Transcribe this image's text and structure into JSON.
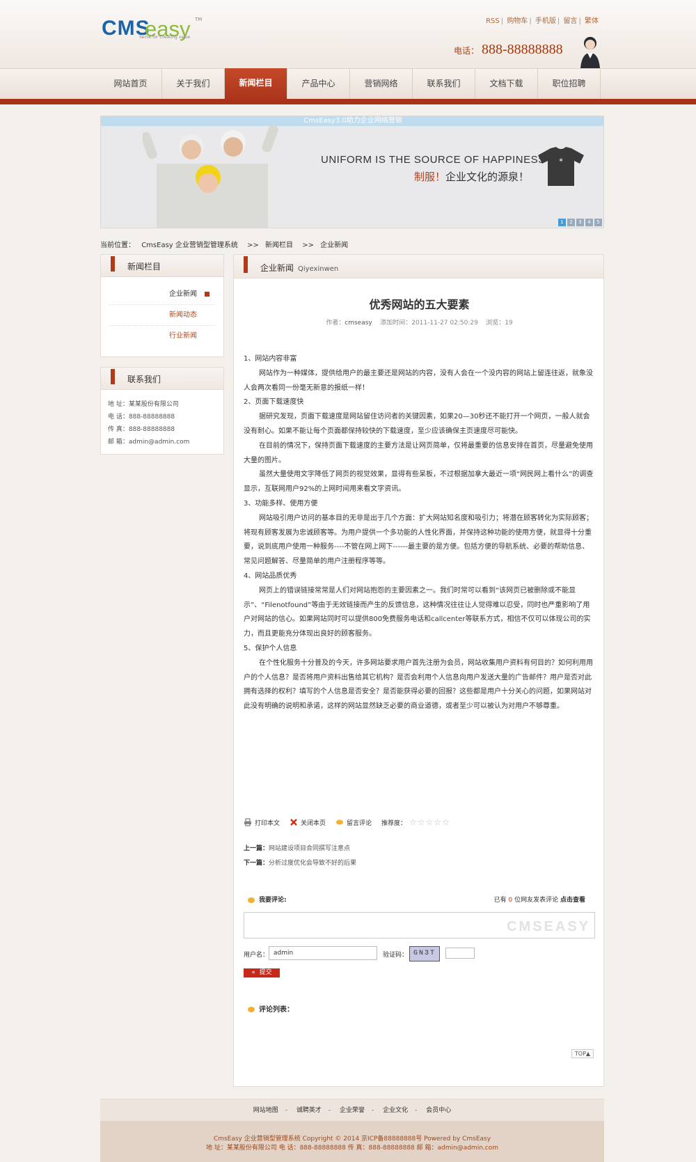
{
  "header": {
    "logo_main": "CMS",
    "logo_accent": "easy",
    "logo_tm": "TM",
    "logo_tagline": "Serve for Creating value",
    "top_links": [
      "RSS",
      "购物车",
      "手机版",
      "留言",
      "繁体"
    ],
    "phone_label": "电话：",
    "phone_number": "888-88888888"
  },
  "nav": {
    "items": [
      "网站首页",
      "关于我们",
      "新闻栏目",
      "产品中心",
      "营销网络",
      "联系我们",
      "文档下载",
      "职位招聘"
    ],
    "active_index": 2
  },
  "banner": {
    "caption": "CmsEasy3.0助力企业网络营销",
    "line1": "UNIFORM IS THE SOURCE OF HAPPINESS",
    "line2_highlight": "制服！",
    "line2_rest": "企业文化的源泉！",
    "dots": [
      "1",
      "2",
      "3",
      "4",
      "5"
    ]
  },
  "breadcrumb": {
    "label": "当前位置：",
    "items": [
      "CmsEasy 企业营销型管理系统",
      ">>",
      "新闻栏目",
      ">>",
      "企业新闻"
    ]
  },
  "sidebar": {
    "news_title": "新闻栏目",
    "news_items": [
      "企业新闻",
      "新闻动态",
      "行业新闻"
    ],
    "contact_title": "联系我们",
    "contact_lines": [
      "地 址：某某股份有限公司",
      "电 话：888-88888888",
      "传 真：888-88888888",
      "邮 箱：admin@admin.com"
    ]
  },
  "article": {
    "section_title": "企业新闻",
    "section_sub": "Qiyexinwen",
    "title": "优秀网站的五大要素",
    "meta_author_label": "作者：",
    "meta_author": "cmseasy",
    "meta_time_label": "添加时间：",
    "meta_time": "2011-11-27 02:50:29",
    "meta_views_label": "浏览：",
    "meta_views": "19",
    "paragraphs": [
      {
        "indent": false,
        "text": "1、网站内容非富"
      },
      {
        "indent": true,
        "text": "网站作为一种媒体，提供给用户的最主要还是网站的内容，没有人会在一个没内容的网站上留连往返，就象没人会两次看同一份毫无新意的报纸一样！"
      },
      {
        "indent": false,
        "text": "2、页面下载速度快"
      },
      {
        "indent": true,
        "text": "据研究发现，页面下载速度是网站留住访问者的关键因素，如果20—30秒还不能打开一个网页，一般人就会没有耐心。如果不能让每个页面都保持较快的下载速度，至少应该确保主页速度尽可能快。"
      },
      {
        "indent": true,
        "text": "在目前的情况下，保持页面下载速度的主要方法是让网页简单，仅将最重要的信息安排在首页，尽量避免使用大量的图片。"
      },
      {
        "indent": true,
        "text": "虽然大量使用文字降低了网页的视觉效果，显得有些呆板，不过根据加拿大最近一项“网民网上看什么”的调查显示，互联网用户92%的上网时间用来看文字资讯。"
      },
      {
        "indent": false,
        "text": "3、功能多样、使用方便"
      },
      {
        "indent": true,
        "text": "网站吸引用户访问的基本目的无非是出于几个方面：扩大网站知名度和吸引力；将潜在顾客转化为实际顾客；将现有顾客发展为忠诚顾客等。为用户提供一个多功能的人性化界面，并保持这种功能的使用方便，就显得十分重要，说到底用户使用一种服务----不管在网上网下------最主要的是方便。包括方便的导航系统、必要的帮助信息、常见问题解答、尽量简单的用户注册程序等等。"
      },
      {
        "indent": false,
        "text": "4、网站品质优秀"
      },
      {
        "indent": true,
        "text": "网页上的错误链接常常是人们对网站抱怨的主要因素之一。我们时常可以看到“该网页已被删除或不能显示”、“Filenotfound”等由于无效链接而产生的反馈信息，这种情况往往让人觉得难以忍受，同时也严重影响了用户对网站的信心。如果网站同时可以提供800免费服务电话和callcenter等联系方式，相信不仅可以体现公司的实力，而且更能充分体现出良好的顾客服务。"
      },
      {
        "indent": false,
        "text": "5、保护个人信息"
      },
      {
        "indent": true,
        "text": "在个性化服务十分普及的今天，许多网站要求用户首先注册为会员，网站收集用户资料有何目的？如何利用用户的个人信息？是否将用户资料出售给其它机构？是否会利用个人信息向用户发送大量的广告邮件？用户是否对此拥有选择的权利？填写的个人信息是否安全？是否能获得必要的回报？这些都是用户十分关心的问题，如果网站对此没有明确的说明和承诺，这样的网站显然缺乏必要的商业道德，或者至少可以被认为对用户不够尊重。"
      }
    ],
    "tool_print": "打印本文",
    "tool_close": "关闭本页",
    "tool_comment": "留言评论",
    "tool_rating": "推荐度：",
    "rating": 0,
    "rating_max": 5,
    "prev_label": "上一篇：",
    "prev_title": "网站建设项目合同撰写注意点",
    "next_label": "下一篇：",
    "next_title": "分析过度优化会导致不好的后果"
  },
  "comments": {
    "heading": "我要评论:",
    "count_prefix": "已有",
    "count": "0",
    "count_suffix": "位网友发表评论",
    "view_link": "点击查看",
    "watermark": "CMSEASY",
    "username_label": "用户名：",
    "username_value": "admin",
    "code_label": "验证码：",
    "code_image_text": "GN3T",
    "submit_label": "提交",
    "submit_arrows": "«",
    "list_heading": "评论列表：",
    "top_button": "TOP▲"
  },
  "footer": {
    "links": [
      "网站地图",
      "诚聘英才",
      "企业荣誉",
      "企业文化",
      "会员中心"
    ],
    "separator": "-",
    "copy_line1": "CmsEasy 企业营销型管理系统  Copyright © 2014  京ICP备88888888号  Powered by CmsEasy",
    "copy_line2": "地 址：某某股份有限公司  电 话：888-88888888  传 真：888-88888888  邮 箱：admin@admin.com"
  }
}
